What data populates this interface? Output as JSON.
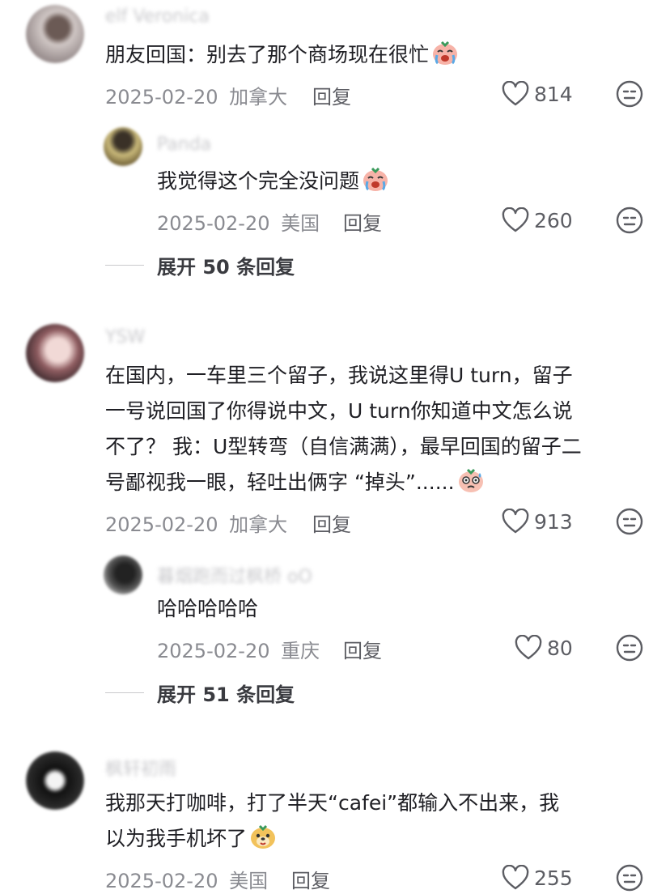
{
  "comments": [
    {
      "username": "elf Veronica",
      "text_lines": [
        "朋友回国：别去了那个商场现在很忙"
      ],
      "emoji": "crying-face-emoji",
      "date": "2025-02-20",
      "region": "加拿大",
      "reply_label": "回复",
      "likes": "814",
      "replies": [
        {
          "username": "Panda",
          "text_lines": [
            "我觉得这个完全没问题"
          ],
          "emoji": "crying-face-emoji",
          "date": "2025-02-20",
          "region": "美国",
          "reply_label": "回复",
          "likes": "260"
        }
      ],
      "expand_label": "展开 50 条回复"
    },
    {
      "username": "YSW",
      "text_lines": [
        "在国内，一车里三个留子，我说这里得U turn，留子",
        "一号说回国了你得说中文，U turn你知道中文怎么说",
        "不了？ 我：U型转弯（自信满满），最早回国的留子二",
        "号鄙视我一眼，轻吐出俩字 “掉头”......"
      ],
      "emoji": "sweat-face-emoji",
      "date": "2025-02-20",
      "region": "加拿大",
      "reply_label": "回复",
      "likes": "913",
      "replies": [
        {
          "username": "暮烟跑而过枫桥 oO",
          "text_lines": [
            "哈哈哈哈哈"
          ],
          "date": "2025-02-20",
          "region": "重庆",
          "reply_label": "回复",
          "likes": "80"
        }
      ],
      "expand_label": "展开 51 条回复"
    },
    {
      "username": "枫轩初雨",
      "text_lines": [
        "我那天打咖啡，打了半天“cafei”都输入不出来，我",
        "以为我手机坏了"
      ],
      "emoji": "dog-face-emoji",
      "date": "2025-02-20",
      "region": "美国",
      "reply_label": "回复",
      "likes": "255"
    }
  ],
  "icons": {
    "like": "heart-outline-icon",
    "dislike": "meh-face-icon"
  },
  "colors": {
    "text": "#1f1f24",
    "meta": "#8a8b91",
    "icon": "#5c5d63"
  }
}
